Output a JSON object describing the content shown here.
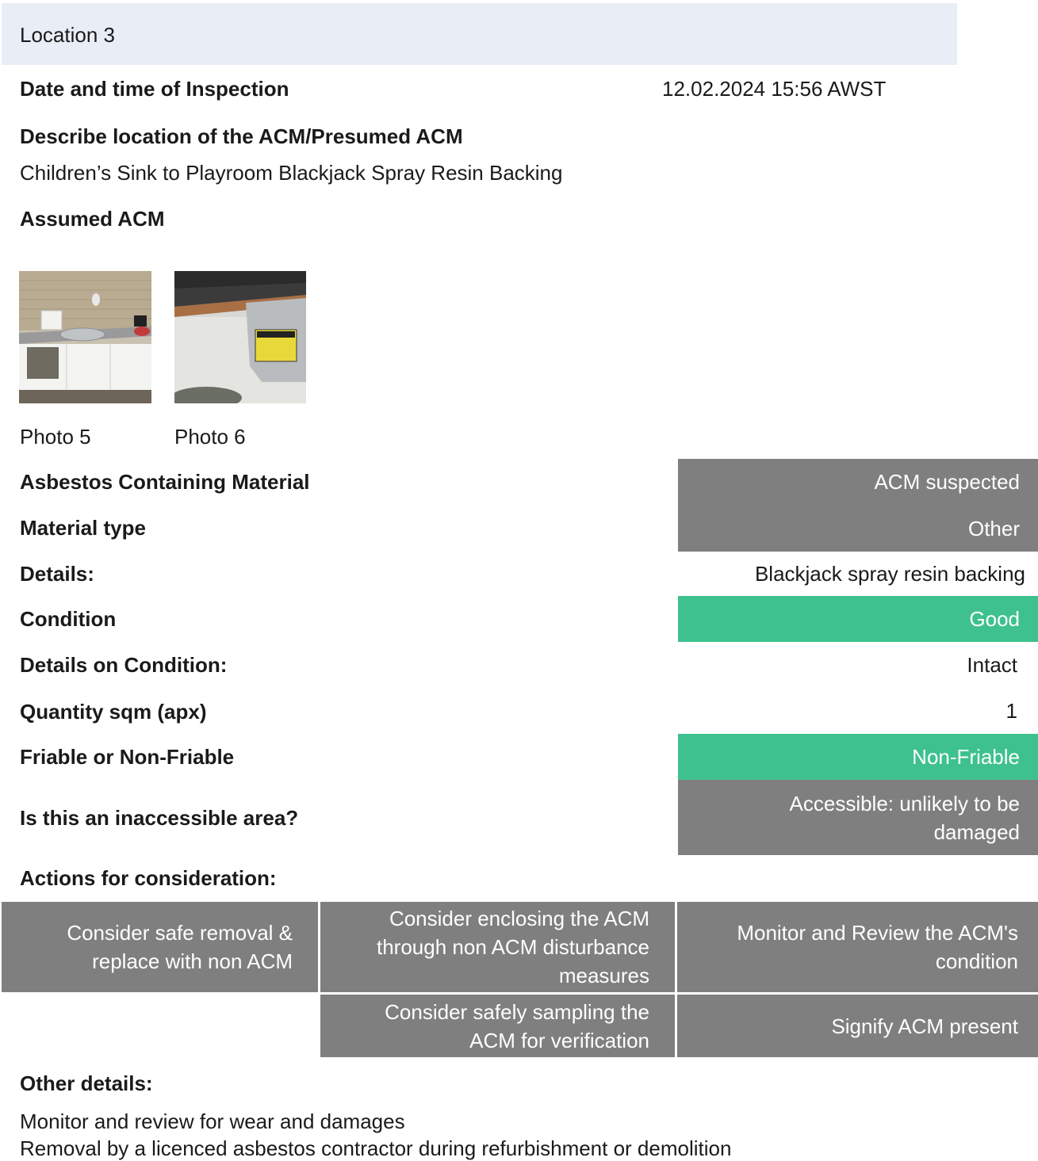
{
  "header": {
    "title": "Location 3"
  },
  "inspection": {
    "label": "Date and time of Inspection",
    "value": "12.02.2024 15:56 AWST"
  },
  "location": {
    "label": "Describe location of the ACM/Presumed ACM",
    "value": "Children’s Sink to Playroom Blackjack Spray Resin Backing"
  },
  "assumed": {
    "label": "Assumed ACM"
  },
  "photos": [
    {
      "caption": "Photo 5"
    },
    {
      "caption": "Photo 6"
    }
  ],
  "fields": {
    "acm": {
      "label": "Asbestos Containing Material",
      "value": "ACM suspected"
    },
    "material": {
      "label": "Material type",
      "value": "Other"
    },
    "details": {
      "label": "Details:",
      "value": "Blackjack spray resin backing"
    },
    "condition": {
      "label": "Condition",
      "value": "Good"
    },
    "condition_details": {
      "label": "Details on Condition:",
      "value": "Intact"
    },
    "quantity": {
      "label": "Quantity sqm (apx)",
      "value": "1"
    },
    "friable": {
      "label": "Friable or Non-Friable",
      "value": "Non-Friable"
    },
    "inaccessible": {
      "label": "Is this an inaccessible area?",
      "value_line1": "Accessible: unlikely to be",
      "value_line2": "damaged"
    }
  },
  "colors": {
    "gray": "#7f7f7f",
    "green": "#3ec18e",
    "header": "#e9edf6"
  },
  "actions": {
    "label": "Actions for consideration:",
    "items": [
      {
        "line1": "Consider safe removal &",
        "line2": "replace with non ACM"
      },
      {
        "line1": "Consider enclosing the ACM",
        "line2": "through non ACM disturbance",
        "line3": "measures"
      },
      {
        "line1": "Monitor and Review the ACM's",
        "line2": "condition"
      },
      {
        "line1": "Consider safely sampling the",
        "line2": "ACM for verification"
      },
      {
        "line1": "Signify ACM present"
      }
    ]
  },
  "other": {
    "label": "Other details:",
    "line1": "Monitor and review for wear and damages",
    "line2": "Removal by a licenced asbestos contractor during refurbishment or demolition"
  }
}
